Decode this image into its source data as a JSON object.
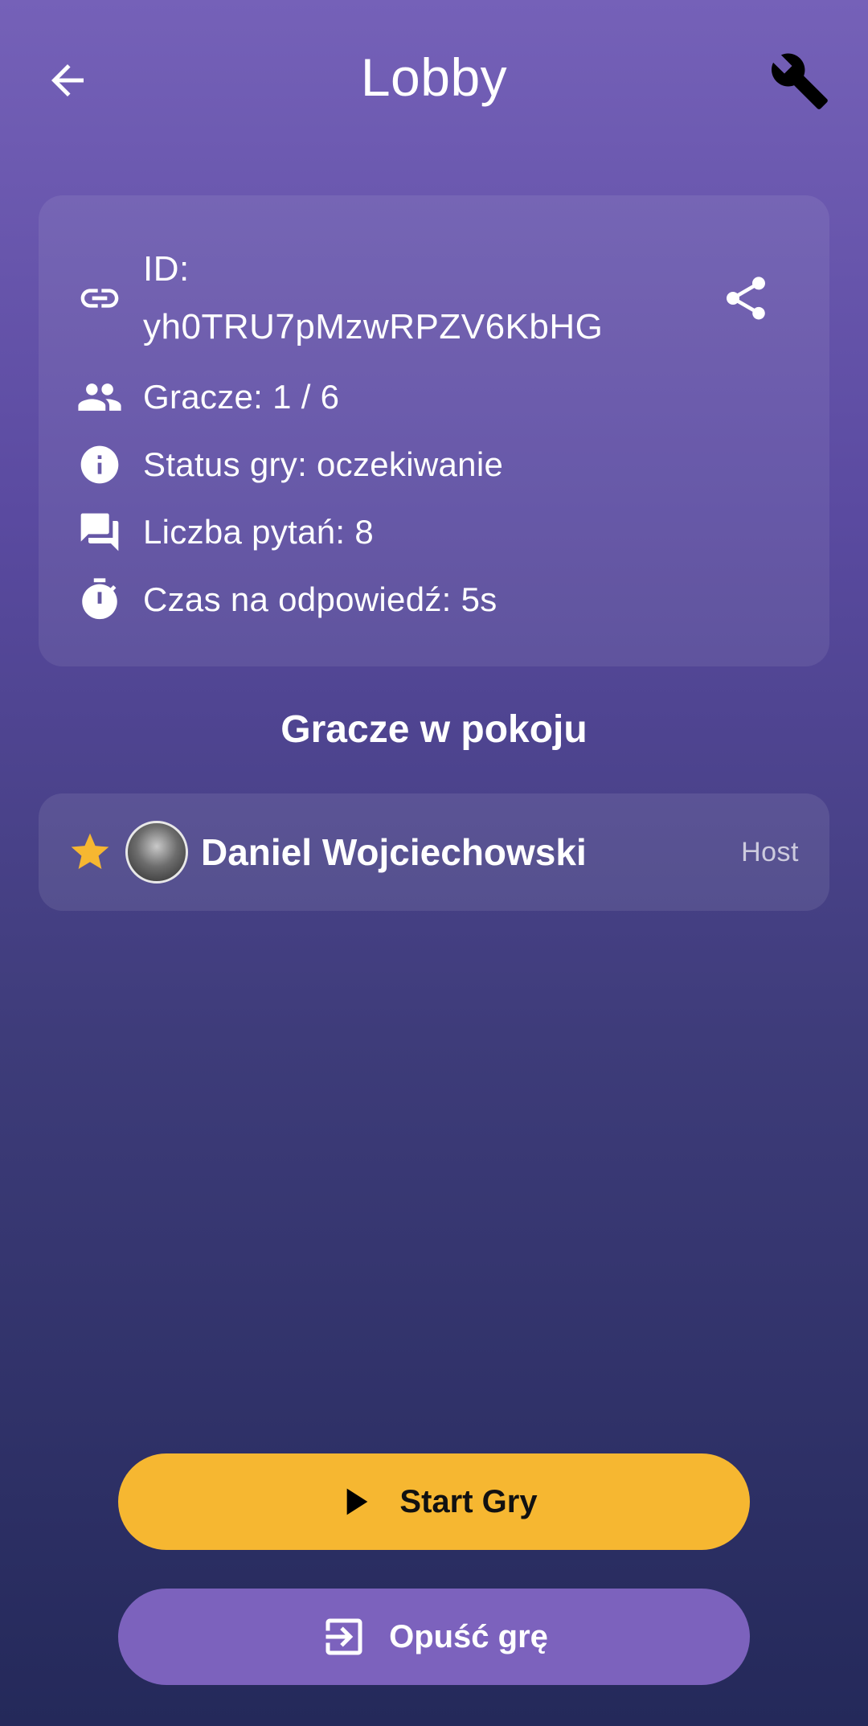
{
  "header": {
    "title": "Lobby",
    "back_icon": "arrow-left-icon",
    "settings_icon": "wrench-icon"
  },
  "room_info": {
    "id_label": "ID:",
    "id_value": "yh0TRU7pMzwRPZV6KbHG",
    "players": "Gracze: 1 / 6",
    "status": "Status gry: oczekiwanie",
    "questions": "Liczba pytań: 8",
    "answer_time": "Czas na odpowiedź: 5s"
  },
  "players_section": {
    "title": "Gracze w pokoju",
    "players": [
      {
        "name": "Daniel Wojciechowski",
        "role": "Host"
      }
    ]
  },
  "actions": {
    "start_label": "Start Gry",
    "leave_label": "Opuść grę"
  },
  "colors": {
    "accent_yellow": "#f6b731",
    "accent_purple": "#7c62bd",
    "star": "#f6b731"
  }
}
